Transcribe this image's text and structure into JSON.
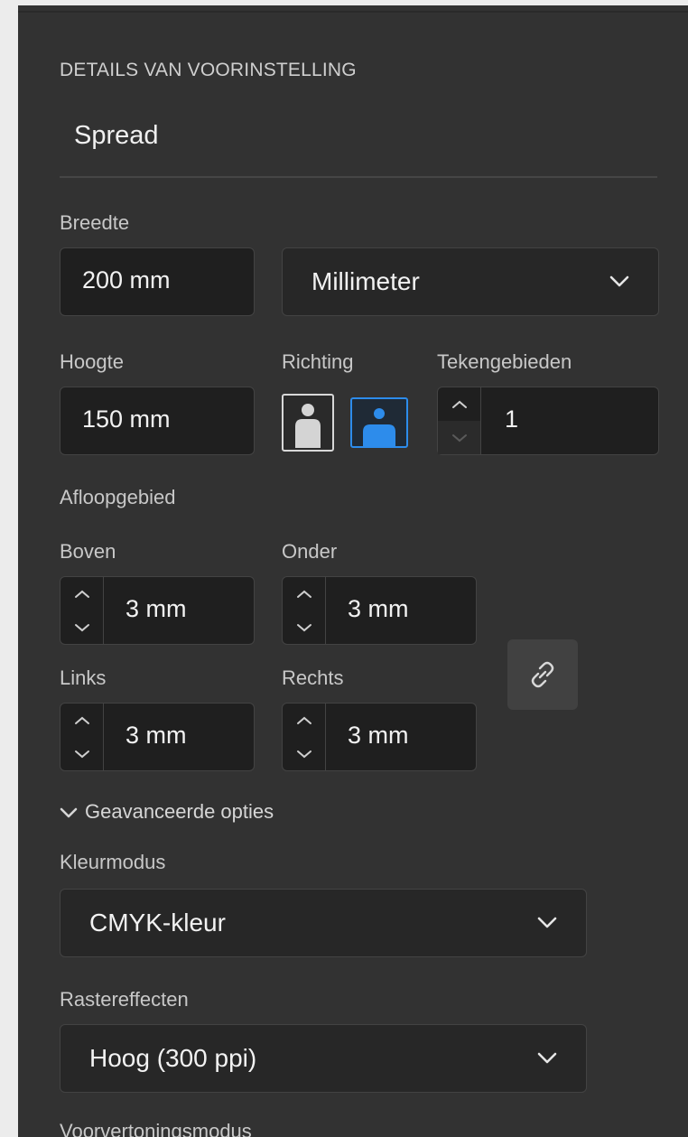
{
  "panel": {
    "section_title": "DETAILS VAN VOORINSTELLING",
    "preset_name": "Spread"
  },
  "width": {
    "label": "Breedte",
    "value": "200 mm",
    "unit_select": "Millimeter"
  },
  "height": {
    "label": "Hoogte",
    "value": "150 mm"
  },
  "orientation": {
    "label": "Richting",
    "selected": "landscape",
    "accent_color": "#2d8ceb"
  },
  "artboards": {
    "label": "Tekengebieden",
    "value": "1"
  },
  "bleed": {
    "label": "Afloopgebied",
    "top": {
      "label": "Boven",
      "value": "3 mm"
    },
    "bottom": {
      "label": "Onder",
      "value": "3 mm"
    },
    "left": {
      "label": "Links",
      "value": "3 mm"
    },
    "right": {
      "label": "Rechts",
      "value": "3 mm"
    },
    "link_icon": "link-icon"
  },
  "advanced": {
    "toggle_label": "Geavanceerde opties",
    "color_mode": {
      "label": "Kleurmodus",
      "value": "CMYK-kleur"
    },
    "raster_effects": {
      "label": "Rastereffecten",
      "value": "Hoog (300 ppi)"
    },
    "preview_mode": {
      "label": "Voorvertoningsmodus"
    }
  }
}
